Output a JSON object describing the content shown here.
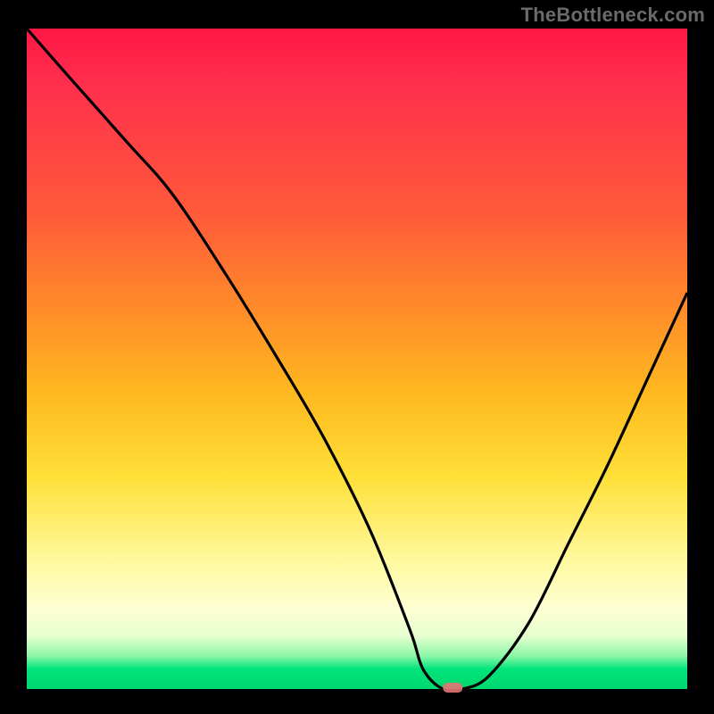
{
  "watermark": "TheBottleneck.com",
  "colors": {
    "frame": "#000000",
    "gradient_top": "#ff1744",
    "gradient_mid": "#ffe038",
    "gradient_bottom": "#00d96f",
    "curve": "#000000",
    "marker": "#e57373",
    "watermark": "#6a6a6a"
  },
  "chart_data": {
    "type": "line",
    "title": "",
    "xlabel": "",
    "ylabel": "",
    "xlim": [
      0,
      100
    ],
    "ylim": [
      0,
      100
    ],
    "x": [
      0,
      7,
      15,
      22,
      30,
      38,
      45,
      52,
      58,
      60,
      63,
      66,
      70,
      76,
      82,
      88,
      94,
      100
    ],
    "values": [
      100,
      92,
      83,
      75,
      63,
      50,
      38,
      24,
      9,
      3,
      0,
      0,
      2,
      10,
      22,
      34,
      47,
      60
    ],
    "marker_point": {
      "x": 64.5,
      "y": 0
    },
    "annotations": []
  }
}
